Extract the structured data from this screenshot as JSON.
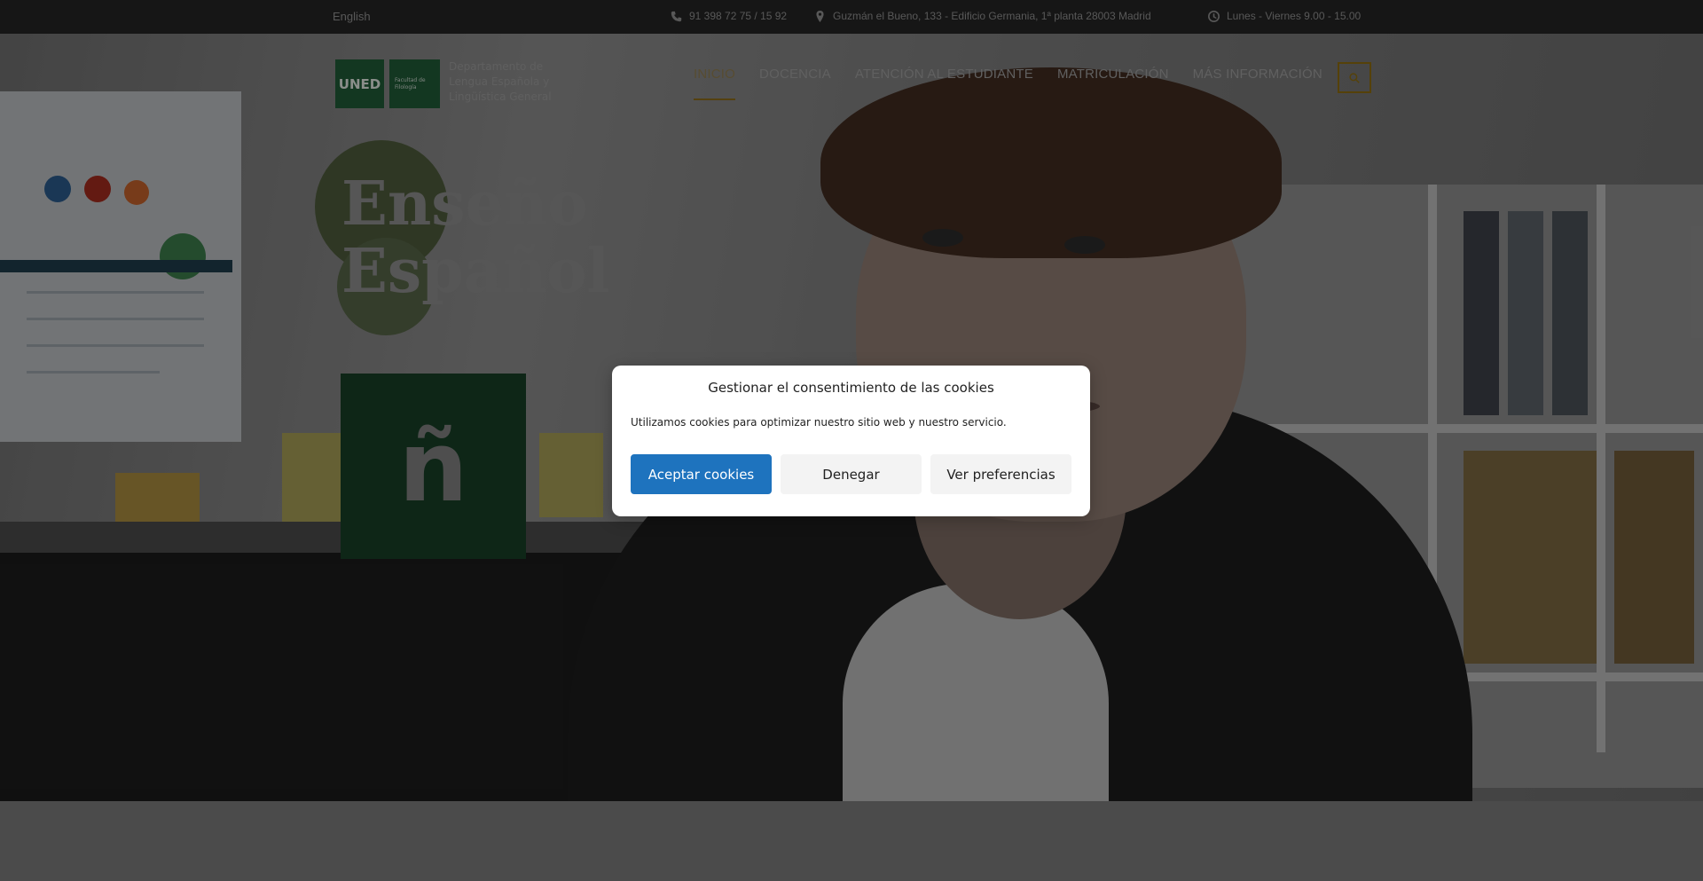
{
  "topbar": {
    "language": "English",
    "phone": "91 398 72 75 / 15 92",
    "address": "Guzmán el Bueno, 133 - Edificio Germania, 1ª planta 28003 Madrid",
    "hours": "Lunes - Viernes 9.00 - 15.00",
    "icons": [
      "phone-icon",
      "location-pin-icon",
      "clock-icon"
    ]
  },
  "header": {
    "logo": {
      "mark": "UNED",
      "faculty": "Facultad de Filología",
      "department": "Departamento de Lengua Española y Lingüística General"
    },
    "nav": [
      {
        "label": "INICIO",
        "active": true
      },
      {
        "label": "DOCENCIA",
        "active": false
      },
      {
        "label": "ATENCIÓN AL ESTUDIANTE",
        "active": false
      },
      {
        "label": "MATRICULACIÓN",
        "active": false
      },
      {
        "label": "MÁS INFORMACIÓN",
        "active": false
      }
    ],
    "search_icon": "search-icon",
    "accent_color": "#8a6a10"
  },
  "hero": {
    "title_line1": "Enseño",
    "title_line2": "Español",
    "badge_letter": "ñ",
    "badge_color": "#173e26"
  },
  "cookie_modal": {
    "title": "Gestionar el consentimiento de las cookies",
    "text": "Utilizamos cookies para optimizar nuestro sitio web y nuestro servicio.",
    "accept_label": "Aceptar cookies",
    "deny_label": "Denegar",
    "preferences_label": "Ver preferencias",
    "accept_color": "#1e73be"
  }
}
